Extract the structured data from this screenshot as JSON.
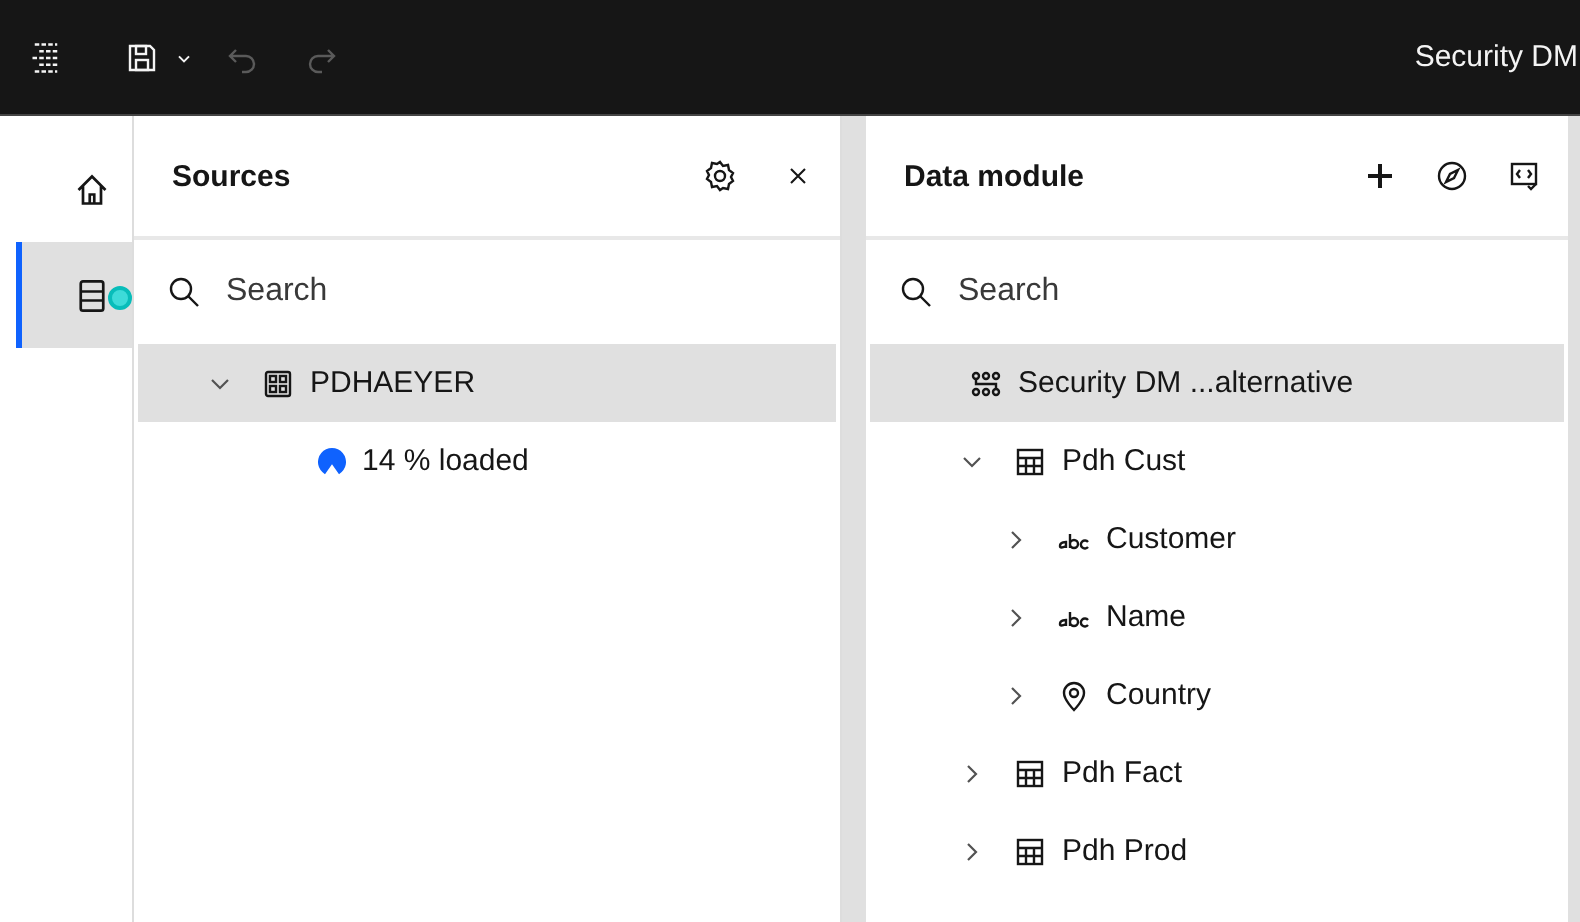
{
  "topbar": {
    "title": "Security DM",
    "undo_disabled": true,
    "redo_disabled": true
  },
  "rail": [
    {
      "kind": "home",
      "selected": false,
      "status": false
    },
    {
      "kind": "data",
      "selected": true,
      "status": true
    }
  ],
  "sources": {
    "title": "Sources",
    "search": {
      "placeholder": "Search"
    },
    "tree": [
      {
        "label": "PDHAEYER",
        "kind": "source",
        "expanded": true,
        "selected": true,
        "children": [
          {
            "label": "14 % loaded",
            "kind": "loading",
            "selected": false
          }
        ]
      }
    ]
  },
  "data_module": {
    "title": "Data module",
    "search": {
      "placeholder": "Search"
    },
    "tree": [
      {
        "label": "Security DM ...alternative",
        "kind": "module",
        "selected": true,
        "children": [
          {
            "label": "Pdh Cust",
            "kind": "table",
            "expanded": true,
            "selected": false,
            "children": [
              {
                "label": "Customer",
                "kind": "text",
                "expanded": false,
                "selected": false
              },
              {
                "label": "Name",
                "kind": "text",
                "expanded": false,
                "selected": false
              },
              {
                "label": "Country",
                "kind": "location",
                "expanded": false,
                "selected": false
              }
            ]
          },
          {
            "label": "Pdh Fact",
            "kind": "table",
            "expanded": false,
            "selected": false
          },
          {
            "label": "Pdh Prod",
            "kind": "table",
            "expanded": false,
            "selected": false
          }
        ]
      }
    ]
  }
}
